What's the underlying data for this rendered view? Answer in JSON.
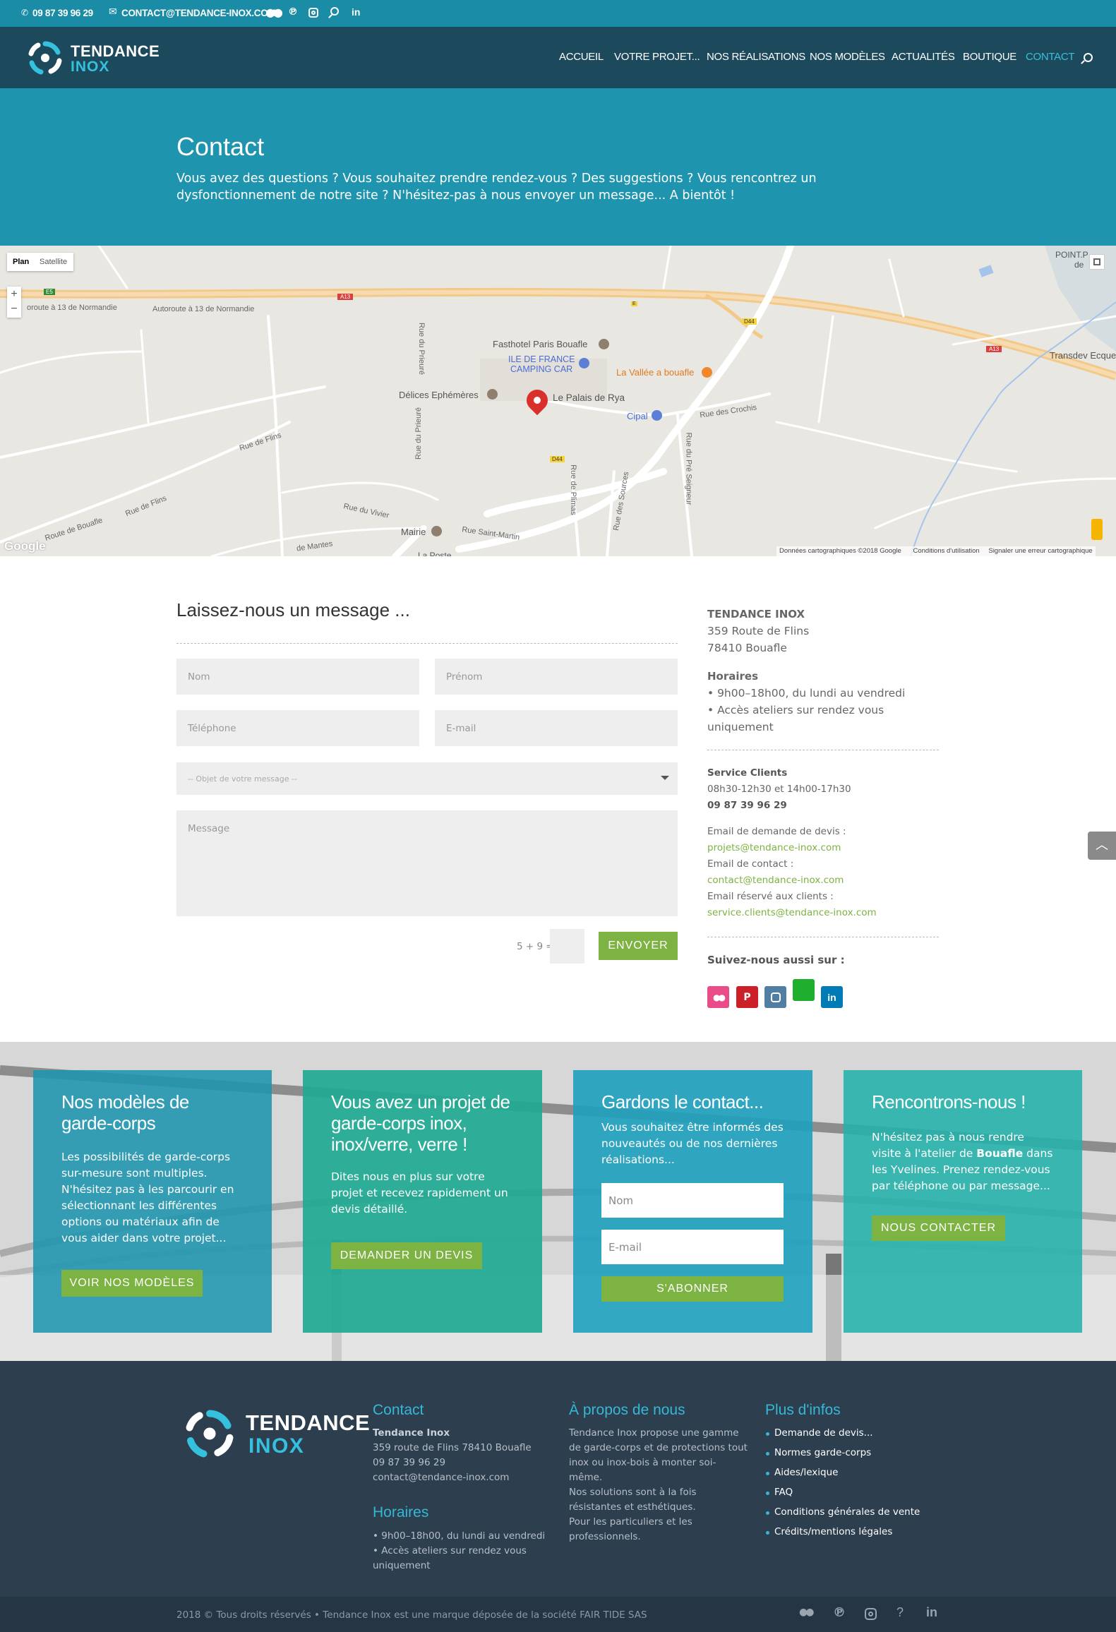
{
  "topbar": {
    "phone": "09 87 39 96 29",
    "email": "CONTACT@TENDANCE-INOX.COM",
    "icons": [
      "phone-icon",
      "mail-icon",
      "flickr-icon",
      "pinterest-icon",
      "instagram-icon",
      "search-icon",
      "linkedin-icon"
    ]
  },
  "header": {
    "logo_line1": "TENDANCE",
    "logo_line2": "INOX",
    "nav": [
      "ACCUEIL",
      "VOTRE PROJET...",
      "NOS RÉALISATIONS",
      "NOS MODÈLES",
      "ACTUALITÉS",
      "BOUTIQUE",
      "CONTACT"
    ],
    "active": "CONTACT"
  },
  "hero": {
    "title": "Contact",
    "text": "Vous avez des questions ? Vous souhaitez prendre rendez-vous ? Des suggestions ? Vous rencontrez un dysfonctionnement de notre site ? N'hésitez-pas à nous envoyer un message... A bientôt !"
  },
  "map": {
    "type_plan": "Plan",
    "type_satellite": "Satellite",
    "zoom_in": "+",
    "zoom_out": "−",
    "labels": {
      "fasthotel": "Fasthotel Paris Bouafle",
      "iledefrance1": "ILE DE FRANCE",
      "iledefrance2": "CAMPING CAR",
      "vallee": "La Vallée a bouafle",
      "delices": "Délices Ephémères",
      "palais": "Le Palais de Rya",
      "cipal": "Cipal",
      "mairie": "Mairie",
      "transdev": "Transdev Ecque",
      "point": "POINT.P",
      "point2": "de",
      "poste": "La Poste"
    },
    "roads": {
      "autoroute1": "oroute à 13 de Normandie",
      "autoroute2": "Autoroute à 13 de Normandie",
      "flins": "Rue de Flins",
      "flins2": "Rue de Flins",
      "bouafle": "Route de Bouafle",
      "prieure1": "Rue du Prieuré",
      "prieure2": "Rue du Prieuré",
      "vivier": "Rue du Vivier",
      "martin": "Rue Saint-Martin",
      "plimas": "Rue de Plimas",
      "sources": "Rue des Sources",
      "preseigneur": "Rue du Pré Seigneur",
      "crochis": "Rue des Crochis",
      "mantes": "de Mantes"
    },
    "shields": [
      "A13",
      "A13",
      "E5",
      "D44",
      "D44",
      "E"
    ],
    "google": "Google",
    "footer_data": "Données cartographiques ©2018 Google",
    "footer_terms": "Conditions d'utilisation",
    "footer_report": "Signaler une erreur cartographique"
  },
  "form": {
    "title": "Laissez-nous un message ...",
    "nom": "Nom",
    "prenom": "Prénom",
    "telephone": "Téléphone",
    "email": "E-mail",
    "objet": "-- Objet de votre message --",
    "message": "Message",
    "captcha": "5 + 9 =",
    "submit": "ENVOYER"
  },
  "info": {
    "company": "TENDANCE INOX",
    "address1": "359 Route de Flins",
    "address2": "78410 Bouafle",
    "hours_title": "Horaires",
    "hours1": "• 9h00–18h00, du lundi au vendredi",
    "hours2": "• Accès ateliers sur rendez vous",
    "hours3": "uniquement",
    "service_title": "Service Clients",
    "service_hours": "08h30-12h30 et 14h00-17h30",
    "service_phone": "09 87 39 96 29",
    "devis_label": "Email de demande de devis :",
    "devis_email": "projets@tendance-inox.com",
    "contact_label": "Email de contact :",
    "contact_email": "contact@tendance-inox.com",
    "clients_label": "Email réservé aux clients :",
    "clients_email": "service.clients@tendance-inox.com",
    "follow": "Suivez-nous aussi sur :",
    "social_colors": [
      "#ea4c89",
      "#cb2027",
      "#517fa4",
      "#1fae2e",
      "#007bb6"
    ]
  },
  "cta": {
    "card1": {
      "title": "Nos modèles de garde-corps",
      "text": "Les possibilités de garde-corps sur-mesure sont multiples. N'hésitez pas à les parcourir en sélectionnant les différentes options ou matériaux afin de vous aider dans votre projet...",
      "button": "VOIR NOS MODÈLES"
    },
    "card2": {
      "title": "Vous avez un projet de garde-corps inox, inox/verre, verre !",
      "text": "Dites nous en plus sur votre projet et recevez rapidement un devis détaillé.",
      "button": "DEMANDER UN DEVIS"
    },
    "card3": {
      "title": "Gardons le contact...",
      "text": "Vous souhaitez être informés des nouveautés ou de nos dernières réalisations...",
      "nom": "Nom",
      "email": "E-mail",
      "button": "S'ABONNER"
    },
    "card4": {
      "title": "Rencontrons-nous !",
      "text_pre": "N'hésitez pas à nous rendre visite à l'atelier de ",
      "text_bold": "Bouafle",
      "text_post": " dans les Yvelines. Prenez rendez-vous par téléphone ou par message...",
      "button": "NOUS CONTACTER"
    }
  },
  "footer": {
    "logo_line1": "TENDANCE",
    "logo_line2": "INOX",
    "contact_title": "Contact",
    "contact_name": "Tendance Inox",
    "contact_addr": "359 route de Flins 78410 Bouafle",
    "contact_phone": "09 87 39 96 29",
    "contact_email": "contact@tendance-inox.com",
    "hours_title": "Horaires",
    "hours1": "• 9h00–18h00, du lundi au vendredi",
    "hours2": "• Accès ateliers sur rendez vous",
    "hours3": "uniquement",
    "about_title": "À propos de nous",
    "about_lines": [
      "Tendance Inox propose une gamme",
      "de garde-corps et de protections tout",
      "inox ou inox-bois à monter soi-",
      "même.",
      "Nos solutions sont à la fois",
      "résistantes et esthétiques.",
      "Pour les particuliers et les",
      "professionnels."
    ],
    "more_title": "Plus d'infos",
    "links": [
      "Demande de devis...",
      "Normes garde-corps",
      "Aides/lexique",
      "FAQ",
      "Conditions générales de vente",
      "Crédits/mentions légales"
    ],
    "copyright": "2018 © Tous droits réservés • Tendance Inox est une marque déposée de la société FAIR TIDE SAS"
  },
  "colors": {
    "teal": "#1e94ae",
    "navy": "#1c4a5c",
    "green": "#7cb342",
    "footer": "#2d3e4f"
  }
}
